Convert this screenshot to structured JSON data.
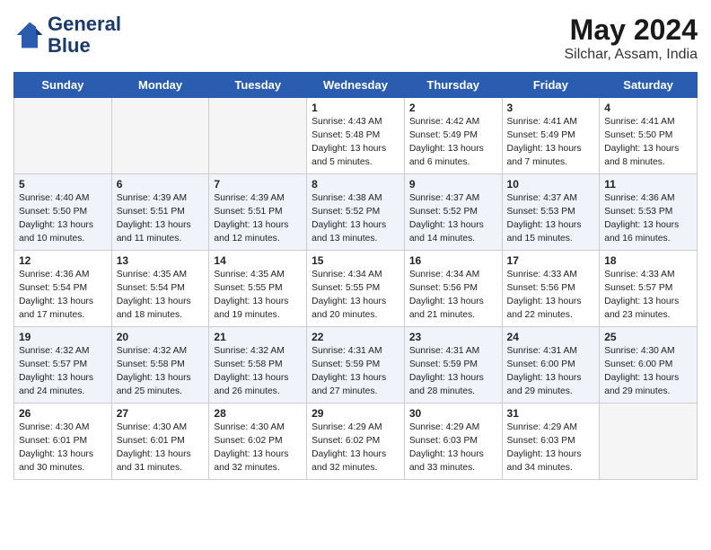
{
  "header": {
    "logo_line1": "General",
    "logo_line2": "Blue",
    "month_year": "May 2024",
    "location": "Silchar, Assam, India"
  },
  "weekdays": [
    "Sunday",
    "Monday",
    "Tuesday",
    "Wednesday",
    "Thursday",
    "Friday",
    "Saturday"
  ],
  "weeks": [
    [
      {
        "day": "",
        "info": "",
        "empty": true
      },
      {
        "day": "",
        "info": "",
        "empty": true
      },
      {
        "day": "",
        "info": "",
        "empty": true
      },
      {
        "day": "1",
        "info": "Sunrise: 4:43 AM\nSunset: 5:48 PM\nDaylight: 13 hours\nand 5 minutes."
      },
      {
        "day": "2",
        "info": "Sunrise: 4:42 AM\nSunset: 5:49 PM\nDaylight: 13 hours\nand 6 minutes."
      },
      {
        "day": "3",
        "info": "Sunrise: 4:41 AM\nSunset: 5:49 PM\nDaylight: 13 hours\nand 7 minutes."
      },
      {
        "day": "4",
        "info": "Sunrise: 4:41 AM\nSunset: 5:50 PM\nDaylight: 13 hours\nand 8 minutes."
      }
    ],
    [
      {
        "day": "5",
        "info": "Sunrise: 4:40 AM\nSunset: 5:50 PM\nDaylight: 13 hours\nand 10 minutes."
      },
      {
        "day": "6",
        "info": "Sunrise: 4:39 AM\nSunset: 5:51 PM\nDaylight: 13 hours\nand 11 minutes."
      },
      {
        "day": "7",
        "info": "Sunrise: 4:39 AM\nSunset: 5:51 PM\nDaylight: 13 hours\nand 12 minutes."
      },
      {
        "day": "8",
        "info": "Sunrise: 4:38 AM\nSunset: 5:52 PM\nDaylight: 13 hours\nand 13 minutes."
      },
      {
        "day": "9",
        "info": "Sunrise: 4:37 AM\nSunset: 5:52 PM\nDaylight: 13 hours\nand 14 minutes."
      },
      {
        "day": "10",
        "info": "Sunrise: 4:37 AM\nSunset: 5:53 PM\nDaylight: 13 hours\nand 15 minutes."
      },
      {
        "day": "11",
        "info": "Sunrise: 4:36 AM\nSunset: 5:53 PM\nDaylight: 13 hours\nand 16 minutes."
      }
    ],
    [
      {
        "day": "12",
        "info": "Sunrise: 4:36 AM\nSunset: 5:54 PM\nDaylight: 13 hours\nand 17 minutes."
      },
      {
        "day": "13",
        "info": "Sunrise: 4:35 AM\nSunset: 5:54 PM\nDaylight: 13 hours\nand 18 minutes."
      },
      {
        "day": "14",
        "info": "Sunrise: 4:35 AM\nSunset: 5:55 PM\nDaylight: 13 hours\nand 19 minutes."
      },
      {
        "day": "15",
        "info": "Sunrise: 4:34 AM\nSunset: 5:55 PM\nDaylight: 13 hours\nand 20 minutes."
      },
      {
        "day": "16",
        "info": "Sunrise: 4:34 AM\nSunset: 5:56 PM\nDaylight: 13 hours\nand 21 minutes."
      },
      {
        "day": "17",
        "info": "Sunrise: 4:33 AM\nSunset: 5:56 PM\nDaylight: 13 hours\nand 22 minutes."
      },
      {
        "day": "18",
        "info": "Sunrise: 4:33 AM\nSunset: 5:57 PM\nDaylight: 13 hours\nand 23 minutes."
      }
    ],
    [
      {
        "day": "19",
        "info": "Sunrise: 4:32 AM\nSunset: 5:57 PM\nDaylight: 13 hours\nand 24 minutes."
      },
      {
        "day": "20",
        "info": "Sunrise: 4:32 AM\nSunset: 5:58 PM\nDaylight: 13 hours\nand 25 minutes."
      },
      {
        "day": "21",
        "info": "Sunrise: 4:32 AM\nSunset: 5:58 PM\nDaylight: 13 hours\nand 26 minutes."
      },
      {
        "day": "22",
        "info": "Sunrise: 4:31 AM\nSunset: 5:59 PM\nDaylight: 13 hours\nand 27 minutes."
      },
      {
        "day": "23",
        "info": "Sunrise: 4:31 AM\nSunset: 5:59 PM\nDaylight: 13 hours\nand 28 minutes."
      },
      {
        "day": "24",
        "info": "Sunrise: 4:31 AM\nSunset: 6:00 PM\nDaylight: 13 hours\nand 29 minutes."
      },
      {
        "day": "25",
        "info": "Sunrise: 4:30 AM\nSunset: 6:00 PM\nDaylight: 13 hours\nand 29 minutes."
      }
    ],
    [
      {
        "day": "26",
        "info": "Sunrise: 4:30 AM\nSunset: 6:01 PM\nDaylight: 13 hours\nand 30 minutes."
      },
      {
        "day": "27",
        "info": "Sunrise: 4:30 AM\nSunset: 6:01 PM\nDaylight: 13 hours\nand 31 minutes."
      },
      {
        "day": "28",
        "info": "Sunrise: 4:30 AM\nSunset: 6:02 PM\nDaylight: 13 hours\nand 32 minutes."
      },
      {
        "day": "29",
        "info": "Sunrise: 4:29 AM\nSunset: 6:02 PM\nDaylight: 13 hours\nand 32 minutes."
      },
      {
        "day": "30",
        "info": "Sunrise: 4:29 AM\nSunset: 6:03 PM\nDaylight: 13 hours\nand 33 minutes."
      },
      {
        "day": "31",
        "info": "Sunrise: 4:29 AM\nSunset: 6:03 PM\nDaylight: 13 hours\nand 34 minutes."
      },
      {
        "day": "",
        "info": "",
        "empty": true
      }
    ]
  ]
}
